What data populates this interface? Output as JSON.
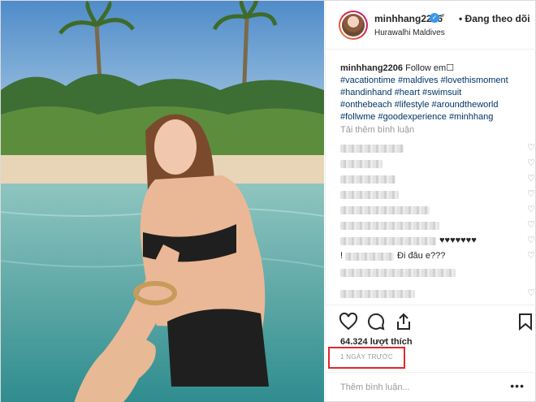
{
  "header": {
    "username": "minhhang2206",
    "follow_status": "• Đang theo dõi",
    "location": "Hurawalhi Maldives"
  },
  "caption": {
    "username": "minhhang2206",
    "text": "Follow em☐",
    "hashtags": [
      "#vacationtime",
      "#maldives",
      "#lovethismoment",
      "#handinhand",
      "#heart",
      "#swimsuit",
      "#onthebeach",
      "#lifestyle",
      "#aroundtheworld",
      "#follwme",
      "#goodexperience",
      "#minhhang"
    ]
  },
  "load_more": "Tải thêm bình luận",
  "comments": [
    {
      "text": ""
    },
    {
      "text": ""
    },
    {
      "text": ""
    },
    {
      "text": ""
    },
    {
      "text": ""
    },
    {
      "text": ""
    },
    {
      "text": "♥♥♥♥♥♥♥"
    },
    {
      "text": "Đi đâu e???"
    },
    {
      "text": ""
    }
  ],
  "likes": "64.324 lượt thích",
  "timestamp": "1 NGÀY TRƯỚC",
  "add_comment": {
    "placeholder": "Thêm bình luận..."
  },
  "more_options": "•••",
  "colors": {
    "accent": "#3897f0",
    "highlight": "#e0272c",
    "hashtag": "#003569"
  },
  "icons": [
    "heart-icon",
    "comment-icon",
    "share-icon",
    "bookmark-icon",
    "verified-icon"
  ]
}
